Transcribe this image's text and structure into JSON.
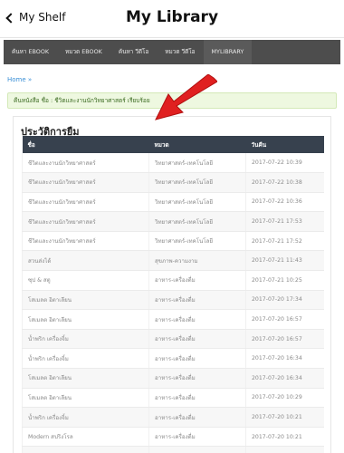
{
  "header": {
    "back_label": "My Shelf",
    "title": "My Library"
  },
  "nav": {
    "items": [
      "ค้นหา EBOOK",
      "หมวด EBOOK",
      "ค้นหา วีดีโอ",
      "หมวด วีดีโอ",
      "MYLIBRARY"
    ],
    "active_index": 4
  },
  "breadcrumb": "Home »",
  "alert": {
    "message": "คืนหนังสือ ชื่อ : ชีวิตและงานนักวิทยาศาสตร์ เรียบร้อย"
  },
  "history": {
    "title": "ประวัติการยืม",
    "columns": [
      "ชื่อ",
      "หมวด",
      "วันคืน"
    ],
    "rows": [
      [
        "ชีวิตและงานนักวิทยาศาสตร์",
        "วิทยาศาสตร์-เทคโนโลยี",
        "2017-07-22 10:39"
      ],
      [
        "ชีวิตและงานนักวิทยาศาสตร์",
        "วิทยาศาสตร์-เทคโนโลยี",
        "2017-07-22 10:38"
      ],
      [
        "ชีวิตและงานนักวิทยาศาสตร์",
        "วิทยาศาสตร์-เทคโนโลยี",
        "2017-07-22 10:36"
      ],
      [
        "ชีวิตและงานนักวิทยาศาสตร์",
        "วิทยาศาสตร์-เทคโนโลยี",
        "2017-07-21 17:53"
      ],
      [
        "ชีวิตและงานนักวิทยาศาสตร์",
        "วิทยาศาสตร์-เทคโนโลยี",
        "2017-07-21 17:52"
      ],
      [
        "สวนส่งได้",
        "สุขภาพ-ความงาม",
        "2017-07-21 11:43"
      ],
      [
        "ซุป & สตู",
        "อาหาร-เครื่องดื่ม",
        "2017-07-21 10:25"
      ],
      [
        "โสเมลต อิตาเลียน",
        "อาหาร-เครื่องดื่ม",
        "2017-07-20 17:34"
      ],
      [
        "โสเมลต อิตาเลียน",
        "อาหาร-เครื่องดื่ม",
        "2017-07-20 16:57"
      ],
      [
        "น้ำพริก เครื่องจิ้ม",
        "อาหาร-เครื่องดื่ม",
        "2017-07-20 16:57"
      ],
      [
        "น้ำพริก เครื่องจิ้ม",
        "อาหาร-เครื่องดื่ม",
        "2017-07-20 16:34"
      ],
      [
        "โสเมลต อิตาเลียน",
        "อาหาร-เครื่องดื่ม",
        "2017-07-20 16:34"
      ],
      [
        "โสเมลต อิตาเลียน",
        "อาหาร-เครื่องดื่ม",
        "2017-07-20 10:29"
      ],
      [
        "น้ำพริก เครื่องจิ้ม",
        "อาหาร-เครื่องดื่ม",
        "2017-07-20 10:21"
      ],
      [
        "Modern สปริงโรล",
        "อาหาร-เครื่องดื่ม",
        "2017-07-20 10:21"
      ],
      [
        "",
        "",
        ""
      ]
    ]
  },
  "colors": {
    "nav_bg": "#4d4d4d",
    "table_header_bg": "#37414e",
    "alert_bg": "#eef8e0",
    "link": "#3a8fd6",
    "arrow": "#e02020"
  },
  "icons": {
    "back": "chevron-left-icon",
    "annotation": "red-arrow-icon"
  }
}
